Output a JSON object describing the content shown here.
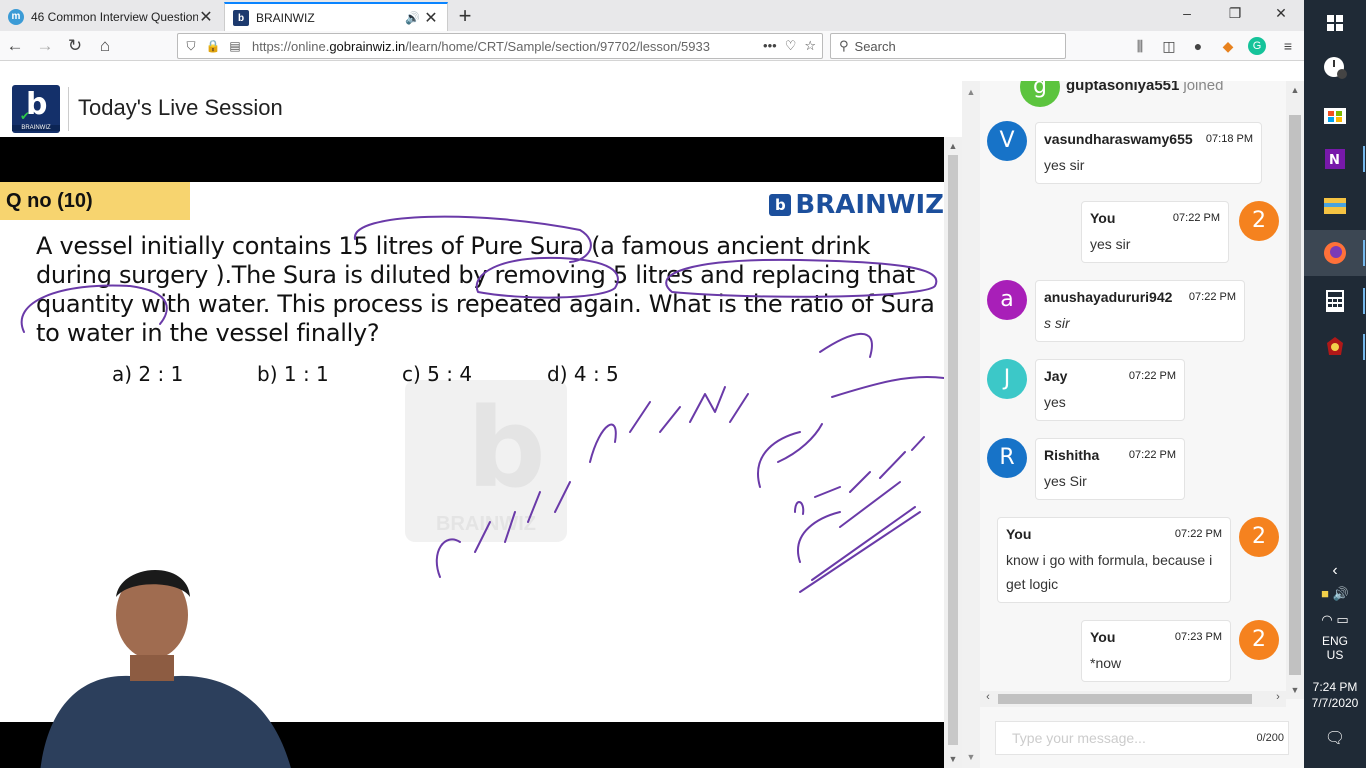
{
  "browser": {
    "tabs": [
      {
        "title": "46 Common Interview Question",
        "favicon": "m",
        "active": false
      },
      {
        "title": "BRAINWIZ",
        "favicon": "b",
        "active": true
      }
    ],
    "new_tab": "+",
    "window_controls": {
      "minimize": "–",
      "restore": "❐",
      "close": "✕"
    },
    "url_prefix": "https://online.",
    "url_domain": "gobrainwiz.in",
    "url_path": "/learn/home/CRT/Sample/section/97702/lesson/5933",
    "url_more": "•••",
    "search_placeholder": "Search"
  },
  "page": {
    "title": "Today's Live Session",
    "logo_text": "BRAINWIZ"
  },
  "slide": {
    "question_tag": "Q no (10)",
    "brand": "BRAINWIZ",
    "question": "A vessel initially contains 15 litres of Pure Sura (a famous ancient drink during surgery ).The Sura is diluted by removing 5 litres and replacing that quantity with water. This process is repeated again. What is the ratio of Sura to water in the vessel finally?",
    "options": [
      "a) 2 : 1",
      "b) 1 : 1",
      "c) 5 : 4",
      "d) 4 : 5"
    ],
    "watermark": "BRAINWIZ"
  },
  "chat": {
    "joined": {
      "user": "guptasoniya551",
      "text": "joined",
      "initial": "g",
      "color": "#5cc43e"
    },
    "messages": [
      {
        "name": "vasundharaswamy655",
        "time": "07:18 PM",
        "text": "yes sir",
        "initial": "V",
        "color": "#1773c8",
        "side": "left",
        "italic": false
      },
      {
        "name": "You",
        "time": "07:22 PM",
        "text": "yes sir",
        "initial": "2",
        "color": "#f5821f",
        "side": "right",
        "italic": false
      },
      {
        "name": "anushayadururi942",
        "time": "07:22 PM",
        "text": "s sir",
        "initial": "a",
        "color": "#a81fb8",
        "side": "left",
        "italic": true
      },
      {
        "name": "Jay",
        "time": "07:22 PM",
        "text": "yes",
        "initial": "J",
        "color": "#3cc8c8",
        "side": "left",
        "italic": false
      },
      {
        "name": "Rishitha",
        "time": "07:22 PM",
        "text": "yes Sir",
        "initial": "R",
        "color": "#1773c8",
        "side": "left",
        "italic": false
      },
      {
        "name": "You",
        "time": "07:22 PM",
        "text": "know i go with formula, because i get logic",
        "initial": "2",
        "color": "#f5821f",
        "side": "right",
        "italic": false
      },
      {
        "name": "You",
        "time": "07:23 PM",
        "text": "*now",
        "initial": "2",
        "color": "#f5821f",
        "side": "right",
        "italic": false
      }
    ],
    "input_placeholder": "Type your message...",
    "char_count": "0/200"
  },
  "taskbar": {
    "lang_line1": "ENG",
    "lang_line2": "US",
    "time": "7:24 PM",
    "date": "7/7/2020",
    "icons": [
      "windows-logo-icon",
      "timer-icon",
      "store-icon",
      "onenote-icon",
      "file-explorer-icon",
      "firefox-icon",
      "calculator-icon",
      "app-icon"
    ]
  }
}
